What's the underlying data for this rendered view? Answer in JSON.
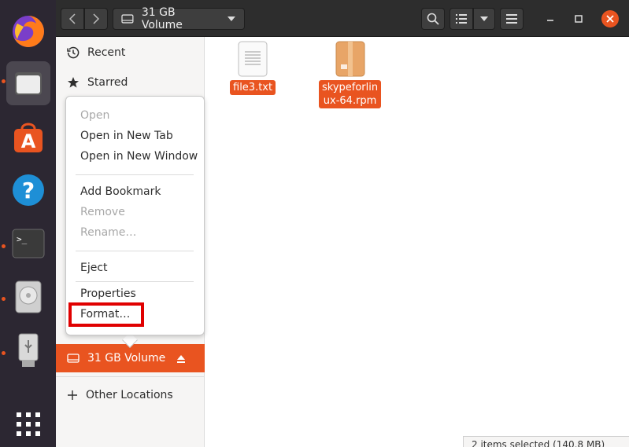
{
  "header": {
    "location": "31 GB Volume"
  },
  "sidebar": {
    "items": [
      {
        "label": "Recent",
        "icon": "clock-icon"
      },
      {
        "label": "Starred",
        "icon": "star-icon"
      },
      {
        "label": "31 GB Volume",
        "icon": "drive-icon"
      },
      {
        "label": "Other Locations",
        "icon": "plus-icon"
      }
    ]
  },
  "files": [
    {
      "name": "file3.txt",
      "icon": "text-file-icon"
    },
    {
      "name_line1": "skypeforlin",
      "name_line2": "ux-64.rpm",
      "icon": "package-icon"
    }
  ],
  "context_menu": {
    "open": "Open",
    "open_new_tab": "Open in New Tab",
    "open_new_window": "Open in New Window",
    "add_bookmark": "Add Bookmark",
    "remove": "Remove",
    "rename": "Rename…",
    "eject": "Eject",
    "properties": "Properties",
    "format": "Format…"
  },
  "status": {
    "text": "2 items selected (140.8 MB)"
  },
  "colors": {
    "accent": "#e95420",
    "dock": "#2c2732",
    "headerbar": "#2d2d2d",
    "highlight": "#e00000"
  }
}
